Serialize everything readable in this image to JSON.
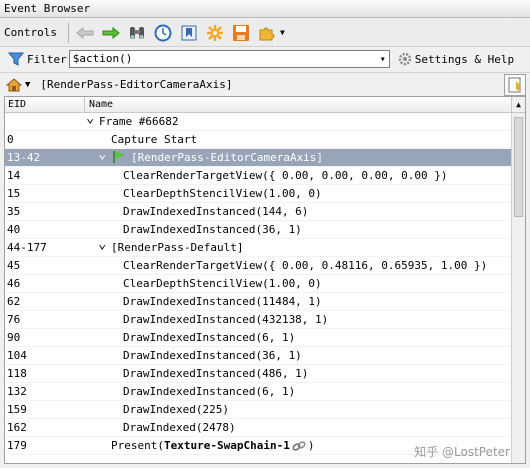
{
  "window": {
    "title": "Event Browser"
  },
  "toolbar": {
    "controls_label": "Controls"
  },
  "filter": {
    "label": "Filter",
    "value": "$action()",
    "settings_label": "Settings & Help"
  },
  "path": {
    "text": "[RenderPass-EditorCameraAxis]"
  },
  "columns": {
    "eid": "EID",
    "name": "Name"
  },
  "rows": [
    {
      "eid": "",
      "name": "Frame #66682",
      "depth": 0,
      "chevron": true
    },
    {
      "eid": "0",
      "name": "Capture Start",
      "depth": 1,
      "chevron": false
    },
    {
      "eid": "13-42",
      "name": "[RenderPass-EditorCameraAxis]",
      "depth": 1,
      "chevron": true,
      "selected": true,
      "flag": true
    },
    {
      "eid": "14",
      "name": "ClearRenderTargetView({ 0.00, 0.00, 0.00, 0.00 })",
      "depth": 2
    },
    {
      "eid": "15",
      "name": "ClearDepthStencilView(1.00, 0)",
      "depth": 2
    },
    {
      "eid": "35",
      "name": "DrawIndexedInstanced(144, 6)",
      "depth": 2
    },
    {
      "eid": "40",
      "name": "DrawIndexedInstanced(36, 1)",
      "depth": 2
    },
    {
      "eid": "44-177",
      "name": "[RenderPass-Default]",
      "depth": 1,
      "chevron": true
    },
    {
      "eid": "45",
      "name": "ClearRenderTargetView({ 0.00, 0.48116, 0.65935, 1.00 })",
      "depth": 2
    },
    {
      "eid": "46",
      "name": "ClearDepthStencilView(1.00, 0)",
      "depth": 2
    },
    {
      "eid": "62",
      "name": "DrawIndexedInstanced(11484, 1)",
      "depth": 2
    },
    {
      "eid": "76",
      "name": "DrawIndexedInstanced(432138, 1)",
      "depth": 2
    },
    {
      "eid": "90",
      "name": "DrawIndexedInstanced(6, 1)",
      "depth": 2
    },
    {
      "eid": "104",
      "name": "DrawIndexedInstanced(36, 1)",
      "depth": 2
    },
    {
      "eid": "118",
      "name": "DrawIndexedInstanced(486, 1)",
      "depth": 2
    },
    {
      "eid": "132",
      "name": "DrawIndexedInstanced(6, 1)",
      "depth": 2
    },
    {
      "eid": "159",
      "name": "DrawIndexed(225)",
      "depth": 2
    },
    {
      "eid": "162",
      "name": "DrawIndexed(2478)",
      "depth": 2
    },
    {
      "eid": "179",
      "name": "Present(",
      "bold_part": "Texture-SwapChain-1",
      "suffix": ")",
      "depth": 1,
      "link_icon": true
    }
  ],
  "watermark": "知乎 @LostPeter",
  "colors": {
    "selected_row": "#98a4b8",
    "flag": "#3fae3f",
    "arrow": "#3a9a2a"
  },
  "icons": [
    "back-arrow-icon",
    "forward-arrow-icon",
    "binoculars-icon",
    "clock-icon",
    "bookmark-icon",
    "save-icon",
    "gear-icon",
    "filter-icon",
    "settings-gear-icon",
    "home-icon",
    "bookmark-add-icon",
    "link-icon",
    "flag-icon"
  ]
}
